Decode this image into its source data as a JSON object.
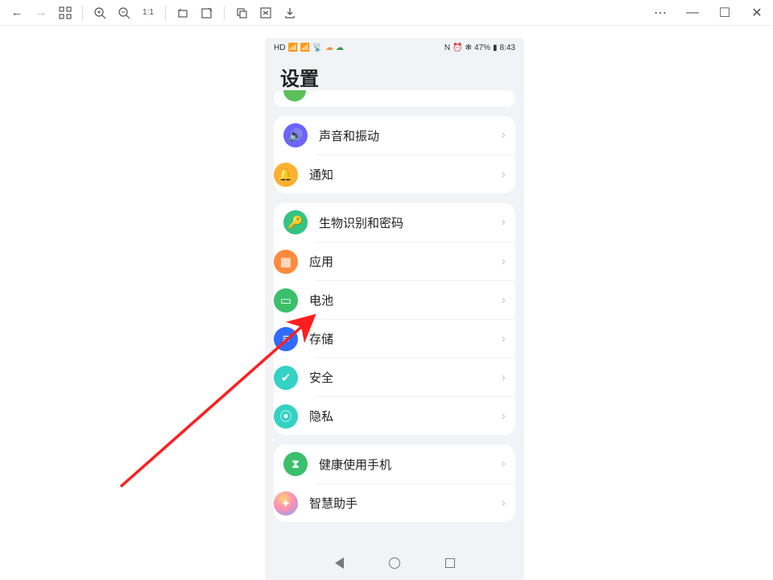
{
  "toolbar": {
    "back": "←",
    "forward": "→",
    "grid": "⊞",
    "zoom_in": "⊕",
    "zoom_out": "⊖",
    "fit": "1:1",
    "rotate_l": "↶",
    "edit": "✎",
    "copy": "⧉",
    "shuffle": "⇄",
    "download": "⭳",
    "more": "⋯",
    "min": "—",
    "max": "☐",
    "close": "✕"
  },
  "phone": {
    "title": "设置",
    "status": {
      "hd": "HD",
      "nfc": "N",
      "alarm": "⏰",
      "bt": "✻",
      "battery_pct": "47%",
      "time": "8:43"
    },
    "nav": {
      "back": "",
      "home": "",
      "recent": ""
    }
  },
  "groups": [
    {
      "rows": [
        {
          "id": "sound",
          "icon": "🔊",
          "cls": "ico-sound",
          "label": "声音和振动"
        },
        {
          "id": "notif",
          "icon": "🔔",
          "cls": "ico-notif",
          "label": "通知"
        }
      ]
    },
    {
      "rows": [
        {
          "id": "bio",
          "icon": "🔑",
          "cls": "ico-bio",
          "label": "生物识别和密码"
        },
        {
          "id": "apps",
          "icon": "▦",
          "cls": "ico-apps",
          "label": "应用"
        },
        {
          "id": "battery",
          "icon": "▭",
          "cls": "ico-batt",
          "label": "电池"
        },
        {
          "id": "storage",
          "icon": "≡",
          "cls": "ico-store",
          "label": "存储"
        },
        {
          "id": "security",
          "icon": "✔",
          "cls": "ico-sec",
          "label": "安全"
        },
        {
          "id": "privacy",
          "icon": "⦿",
          "cls": "ico-priv",
          "label": "隐私"
        }
      ]
    },
    {
      "rows": [
        {
          "id": "health",
          "icon": "⧗",
          "cls": "ico-health",
          "label": "健康使用手机"
        },
        {
          "id": "ai",
          "icon": "✦",
          "cls": "ico-ai",
          "label": "智慧助手"
        }
      ]
    }
  ]
}
